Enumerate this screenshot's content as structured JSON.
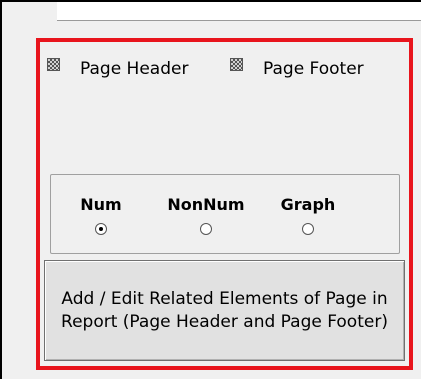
{
  "options": {
    "page_header_label": "Page Header",
    "page_footer_label": "Page Footer"
  },
  "view_mode": {
    "options": [
      {
        "label": "Num",
        "checked": true
      },
      {
        "label": "NonNum",
        "checked": false
      },
      {
        "label": "Graph",
        "checked": false
      }
    ]
  },
  "actions": {
    "edit_related_label": "Add / Edit Related Elements of Page in Report (Page Header and Page Footer)"
  },
  "colors": {
    "highlight_border": "#e8141c",
    "panel_bg": "#f0f0f0"
  }
}
